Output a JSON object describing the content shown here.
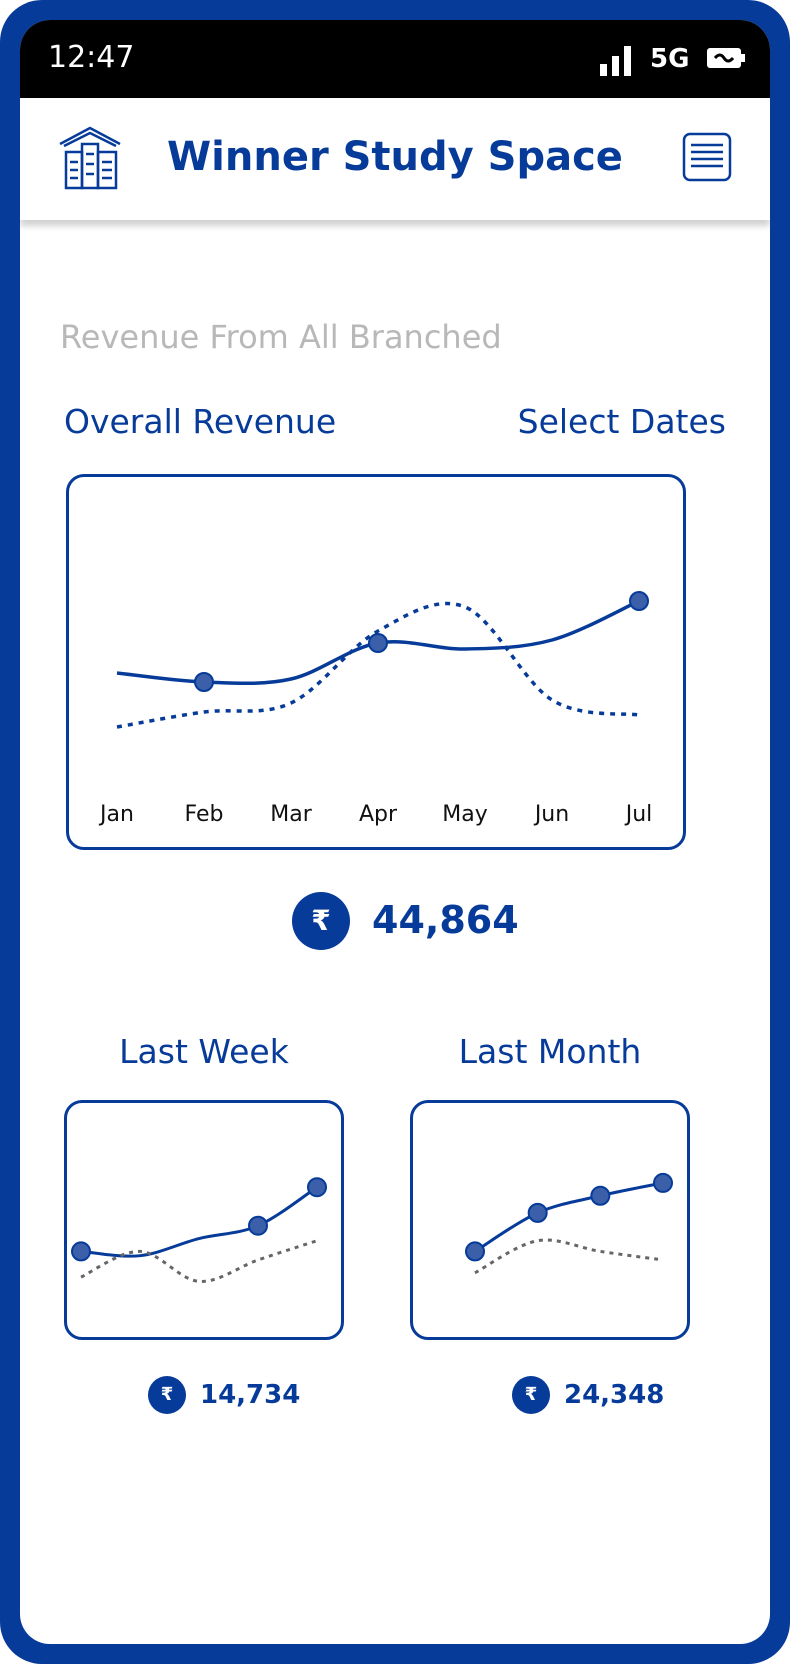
{
  "status": {
    "time": "12:47",
    "network": "5G"
  },
  "header": {
    "title": "Winner Study Space"
  },
  "icons": {
    "logo": "building-icon",
    "menu": "menu-icon",
    "currency": "rupee-icon"
  },
  "colors": {
    "brand": "#073b99",
    "muted": "#b8b8b8",
    "secondary_series": "#666666"
  },
  "page": {
    "subtitle": "Revenue From All Branched",
    "overall_label": "Overall Revenue",
    "select_dates": "Select Dates"
  },
  "overall": {
    "currency_symbol": "₹",
    "total": "44,864"
  },
  "last_week": {
    "label": "Last Week",
    "currency_symbol": "₹",
    "total": "14,734"
  },
  "last_month": {
    "label": "Last Month",
    "currency_symbol": "₹",
    "total": "24,348"
  },
  "chart_data": [
    {
      "type": "line",
      "categories": [
        "Jan",
        "Feb",
        "Mar",
        "Apr",
        "May",
        "Jun",
        "Jul"
      ],
      "series": [
        {
          "values": [
            48,
            45,
            46,
            58,
            56,
            59,
            72
          ],
          "style": "solid",
          "color": "#073b99"
        },
        {
          "values": [
            30,
            35,
            38,
            62,
            70,
            39,
            34
          ],
          "style": "dotted",
          "color": "#073b99"
        }
      ],
      "grid": false
    },
    {
      "type": "line",
      "categories": [],
      "series": [
        {
          "values": [
            40,
            38,
            46,
            52,
            70
          ],
          "style": "solid",
          "color": "#073b99"
        },
        {
          "values": [
            28,
            40,
            26,
            36,
            45
          ],
          "style": "dotted",
          "color": "#666666"
        }
      ],
      "grid": false
    },
    {
      "type": "line",
      "categories": [],
      "series": [
        {
          "values": [
            40,
            58,
            66,
            72
          ],
          "style": "solid",
          "color": "#073b99"
        },
        {
          "values": [
            30,
            45,
            40,
            36
          ],
          "style": "dotted",
          "color": "#666666"
        }
      ],
      "grid": false
    }
  ]
}
